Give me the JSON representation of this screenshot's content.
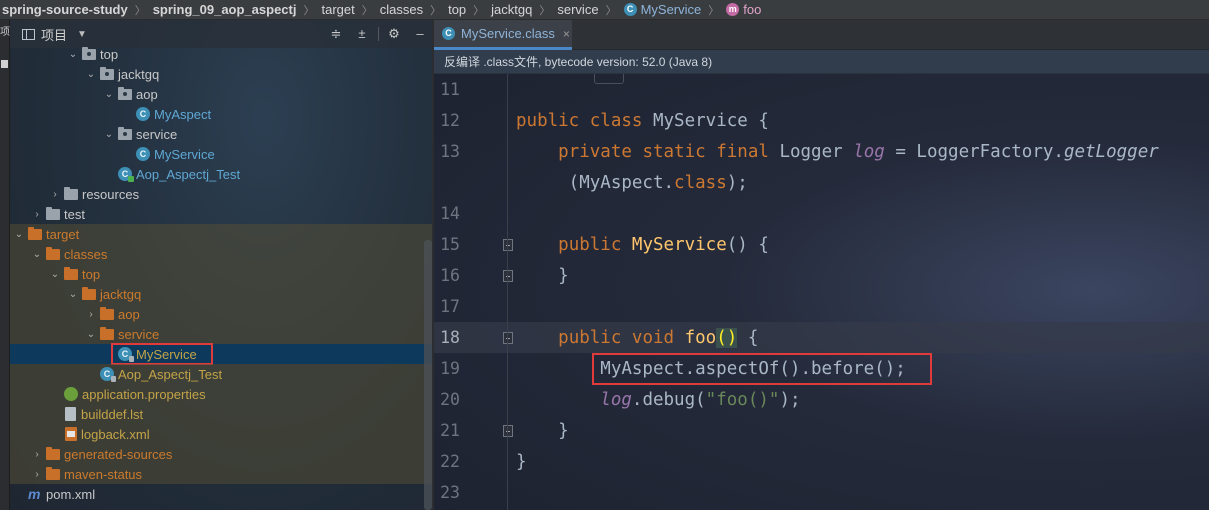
{
  "breadcrumb": [
    {
      "label": "spring-source-study",
      "bold": true,
      "icon": "none"
    },
    {
      "label": "spring_09_aop_aspectj",
      "bold": true,
      "icon": "none"
    },
    {
      "label": "target",
      "bold": false,
      "icon": "none"
    },
    {
      "label": "classes",
      "bold": false,
      "icon": "none"
    },
    {
      "label": "top",
      "bold": false,
      "icon": "none"
    },
    {
      "label": "jacktgq",
      "bold": false,
      "icon": "none"
    },
    {
      "label": "service",
      "bold": false,
      "icon": "none"
    },
    {
      "label": "MyService",
      "bold": false,
      "icon": "class-icon"
    },
    {
      "label": "foo",
      "bold": false,
      "icon": "method-icon"
    }
  ],
  "left_strip": {
    "text": "项"
  },
  "project_panel": {
    "title": "项目",
    "toolbar_icons": [
      "collapse-all-icon",
      "expand-all-icon",
      "gear-icon",
      "hide-icon"
    ]
  },
  "tree": [
    {
      "label": "top",
      "icon": "package",
      "depth": 5,
      "arrow": "down",
      "style": "normal",
      "color": "normal"
    },
    {
      "label": "jacktgq",
      "icon": "package",
      "depth": 6,
      "arrow": "down",
      "style": "normal",
      "color": "normal"
    },
    {
      "label": "aop",
      "icon": "package",
      "depth": 7,
      "arrow": "down",
      "style": "normal",
      "color": "normal"
    },
    {
      "label": "MyAspect",
      "icon": "class",
      "depth": 8,
      "arrow": "none",
      "style": "normal",
      "color": "blue"
    },
    {
      "label": "service",
      "icon": "package",
      "depth": 7,
      "arrow": "down",
      "style": "normal",
      "color": "normal"
    },
    {
      "label": "MyService",
      "icon": "class",
      "depth": 8,
      "arrow": "none",
      "style": "normal",
      "color": "blue"
    },
    {
      "label": "Aop_Aspectj_Test",
      "icon": "class-test",
      "depth": 7,
      "arrow": "none",
      "style": "normal",
      "color": "blue"
    },
    {
      "label": "resources",
      "icon": "folder",
      "depth": 4,
      "arrow": "right",
      "style": "normal",
      "color": "normal"
    },
    {
      "label": "test",
      "icon": "folder",
      "depth": 3,
      "arrow": "right",
      "style": "normal",
      "color": "normal"
    },
    {
      "label": "target",
      "icon": "folder-orange",
      "depth": 2,
      "arrow": "down",
      "style": "excluded",
      "color": "orange"
    },
    {
      "label": "classes",
      "icon": "folder-orange",
      "depth": 3,
      "arrow": "down",
      "style": "excluded",
      "color": "orange"
    },
    {
      "label": "top",
      "icon": "folder-orange",
      "depth": 4,
      "arrow": "down",
      "style": "excluded",
      "color": "orange"
    },
    {
      "label": "jacktgq",
      "icon": "folder-orange",
      "depth": 5,
      "arrow": "down",
      "style": "excluded",
      "color": "orange"
    },
    {
      "label": "aop",
      "icon": "folder-orange",
      "depth": 6,
      "arrow": "right",
      "style": "excluded",
      "color": "orange"
    },
    {
      "label": "service",
      "icon": "folder-orange",
      "depth": 6,
      "arrow": "down",
      "style": "excluded",
      "color": "orange"
    },
    {
      "label": "MyService",
      "icon": "class-lock",
      "depth": 7,
      "arrow": "none",
      "style": "selected",
      "color": "gold",
      "boxed": true
    },
    {
      "label": "Aop_Aspectj_Test",
      "icon": "class-lock",
      "depth": 6,
      "arrow": "none",
      "style": "excluded",
      "color": "gold"
    },
    {
      "label": "application.properties",
      "icon": "leaf",
      "depth": 4,
      "arrow": "none",
      "style": "excluded",
      "color": "gold"
    },
    {
      "label": "builddef.lst",
      "icon": "file",
      "depth": 4,
      "arrow": "none",
      "style": "excluded",
      "color": "gold"
    },
    {
      "label": "logback.xml",
      "icon": "xml",
      "depth": 4,
      "arrow": "none",
      "style": "excluded",
      "color": "gold"
    },
    {
      "label": "generated-sources",
      "icon": "folder-orange",
      "depth": 3,
      "arrow": "right",
      "style": "excluded",
      "color": "orange"
    },
    {
      "label": "maven-status",
      "icon": "folder-orange",
      "depth": 3,
      "arrow": "right",
      "style": "excluded",
      "color": "orange"
    },
    {
      "label": "pom.xml",
      "icon": "maven",
      "depth": 2,
      "arrow": "none",
      "style": "normal",
      "color": "normal"
    }
  ],
  "editor": {
    "tab": {
      "label": "MyService.class",
      "close": "×"
    },
    "notice": "反编译 .class文件, bytecode version: 52.0 (Java 8)",
    "current_line": 18,
    "lines": [
      {
        "n": "11",
        "tokens": []
      },
      {
        "n": "12",
        "tokens": [
          [
            "kw",
            "public "
          ],
          [
            "kw",
            "class "
          ],
          [
            "ty",
            "MyService {"
          ]
        ]
      },
      {
        "n": "13",
        "tokens": [
          [
            "ty",
            "    "
          ],
          [
            "kw",
            "private "
          ],
          [
            "kw",
            "static "
          ],
          [
            "kw",
            "final "
          ],
          [
            "ty",
            "Logger "
          ],
          [
            "fld",
            "log"
          ],
          [
            "ty",
            " = LoggerFactory."
          ],
          [
            "mcall",
            "getLogger"
          ]
        ]
      },
      {
        "n": "",
        "tokens": [
          [
            "ty",
            "     (MyAspect."
          ],
          [
            "kw",
            "class"
          ],
          [
            "ty",
            ");"
          ]
        ]
      },
      {
        "n": "14",
        "tokens": []
      },
      {
        "n": "15",
        "tokens": [
          [
            "ty",
            "    "
          ],
          [
            "kw",
            "public "
          ],
          [
            "fn",
            "MyService"
          ],
          [
            "ty",
            "() {"
          ]
        ]
      },
      {
        "n": "16",
        "tokens": [
          [
            "ty",
            "    }"
          ]
        ]
      },
      {
        "n": "17",
        "tokens": []
      },
      {
        "n": "18",
        "tokens": [
          [
            "ty",
            "    "
          ],
          [
            "kw",
            "public "
          ],
          [
            "kw",
            "void "
          ],
          [
            "fn",
            "foo"
          ],
          [
            "paren",
            "()"
          ],
          [
            "ty",
            " {"
          ]
        ]
      },
      {
        "n": "19",
        "tokens": [
          [
            "ty",
            "        MyAspect.aspectOf().before();"
          ]
        ]
      },
      {
        "n": "20",
        "tokens": [
          [
            "ty",
            "        "
          ],
          [
            "fld",
            "log"
          ],
          [
            "ty",
            ".debug("
          ],
          [
            "str",
            "\"foo()\""
          ],
          [
            "ty",
            ");"
          ]
        ]
      },
      {
        "n": "21",
        "tokens": [
          [
            "ty",
            "    }"
          ]
        ]
      },
      {
        "n": "22",
        "tokens": [
          [
            "ty",
            "}"
          ]
        ]
      },
      {
        "n": "23",
        "tokens": []
      }
    ]
  },
  "colors": {
    "keyword": "#cc7832",
    "method_decl": "#ffc66d",
    "field": "#9876aa",
    "string": "#6a8759",
    "highlight_box": "#e03a3a",
    "excluded_bg": "#544e34",
    "selected_bg": "#0d3a5c"
  }
}
